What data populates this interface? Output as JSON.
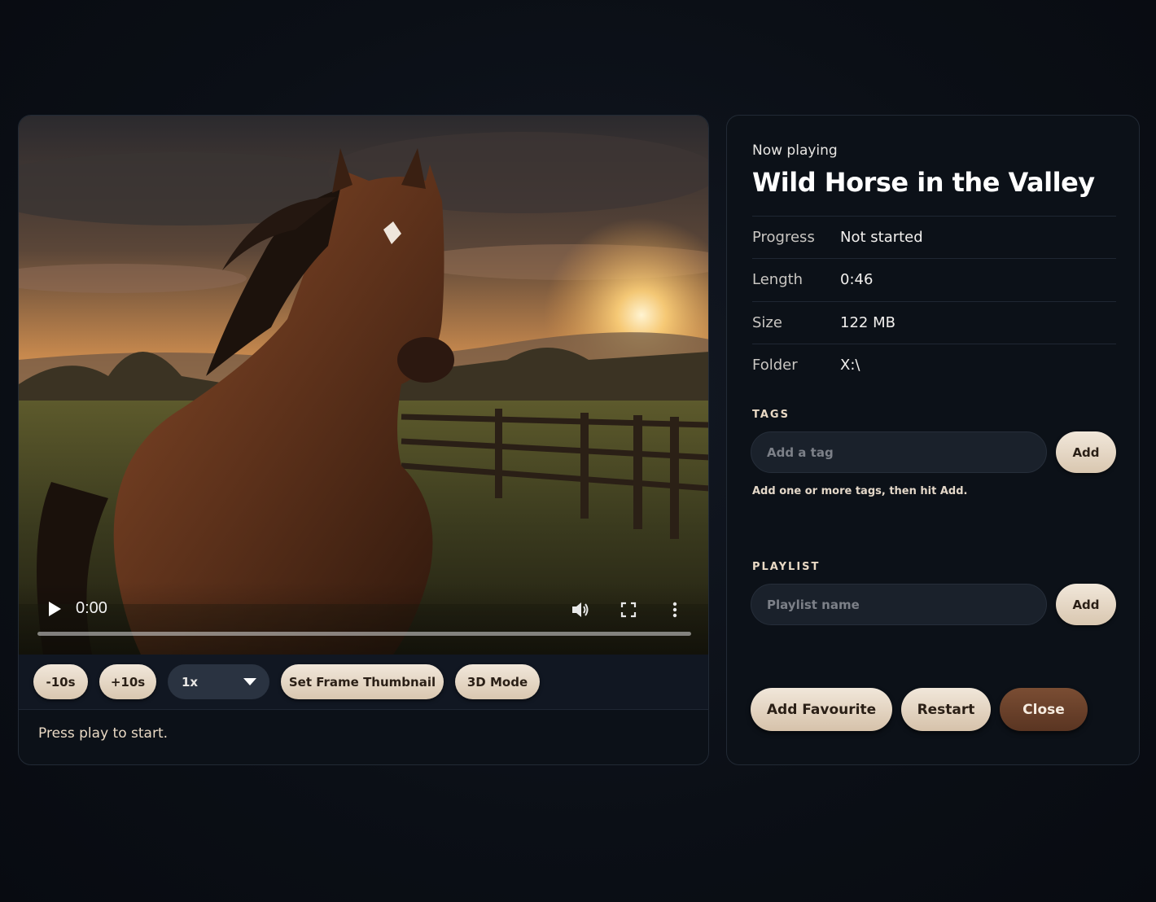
{
  "player": {
    "time": "0:00",
    "progress": 0,
    "status": "Press play to start."
  },
  "toolbar": {
    "back_label": "-10s",
    "forward_label": "+10s",
    "speed_value": "1x",
    "thumbnail_label": "Set Frame Thumbnail",
    "mode_label": "3D Mode"
  },
  "info": {
    "now_playing": "Now playing",
    "title": "Wild Horse in the Valley",
    "meta": [
      {
        "label": "Progress",
        "value": "Not started"
      },
      {
        "label": "Length",
        "value": "0:46"
      },
      {
        "label": "Size",
        "value": "122 MB"
      },
      {
        "label": "Folder",
        "value": "X:\\"
      }
    ]
  },
  "tags": {
    "heading": "TAGS",
    "placeholder": "Add a tag",
    "add_label": "Add",
    "hint": "Add one or more tags, then hit Add."
  },
  "playlist": {
    "heading": "PLAYLIST",
    "placeholder": "Playlist name",
    "add_label": "Add"
  },
  "actions": {
    "favourite_label": "Add Favourite",
    "restart_label": "Restart",
    "close_label": "Close"
  },
  "icons": {
    "play": "play-icon",
    "volume": "volume-icon",
    "fullscreen": "fullscreen-icon",
    "more": "more-vertical-icon",
    "caret": "chevron-down-icon"
  },
  "colors": {
    "accent_light": "#e6d6c2",
    "accent_dark": "#6a412b",
    "background": "#0b0f16"
  }
}
